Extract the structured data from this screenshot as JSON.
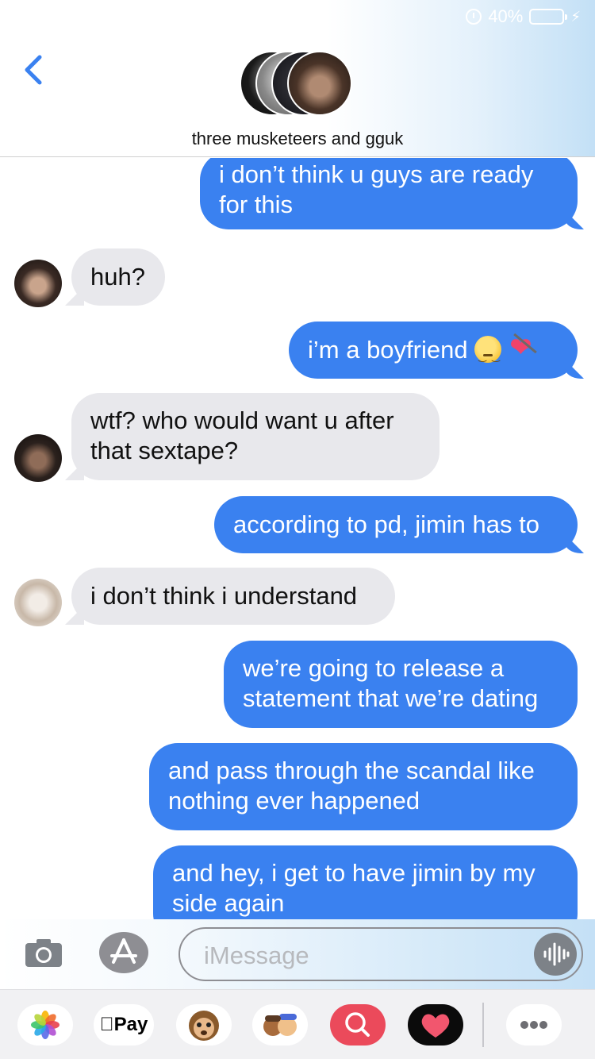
{
  "status_bar": {
    "battery_percent": "40%",
    "battery_level": 0.4,
    "alarm_icon": "alarm-clock-icon",
    "charging_icon": "bolt-icon"
  },
  "header": {
    "group_name": "three musketeers and gguk",
    "back_icon": "chevron-left-icon",
    "accent_color": "#3a81f0"
  },
  "messages": [
    {
      "direction": "sent",
      "text": "i don’t think u guys are ready for this"
    },
    {
      "direction": "received",
      "text": "huh?"
    },
    {
      "direction": "sent",
      "text": "i’m a boyfriend",
      "emojis": [
        "pensive-face",
        "heart-with-arrow"
      ]
    },
    {
      "direction": "received",
      "text": "wtf? who would want u after that sextape?"
    },
    {
      "direction": "sent",
      "text": "according to pd, jimin has to"
    },
    {
      "direction": "received",
      "text": "i don’t think i understand"
    },
    {
      "direction": "sent",
      "text": "we’re going to release a statement that we’re dating"
    },
    {
      "direction": "sent",
      "text": "and pass through the scandal like nothing ever happened"
    },
    {
      "direction": "sent",
      "text": "and hey, i get to have jimin by my side again"
    }
  ],
  "input": {
    "placeholder": "iMessage"
  },
  "app_drawer": {
    "items": [
      "photos-icon",
      "apple-pay-icon",
      "animoji-icon",
      "memoji-icon",
      "images-search-icon",
      "digital-touch-icon",
      "more-icon"
    ],
    "apple_pay_label": "Pay"
  },
  "colors": {
    "sent_bubble": "#3a81f0",
    "received_bubble": "#e8e8ec"
  }
}
